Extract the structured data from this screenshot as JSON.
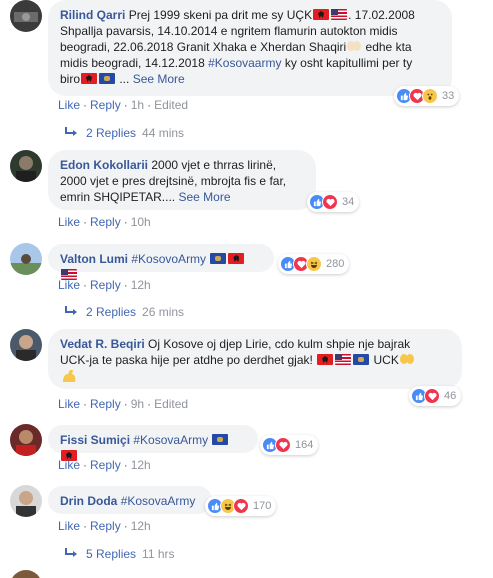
{
  "comments": [
    {
      "author": "Rilind Qarri",
      "text1": "Prej 1999 skeni pa drit me sy UÇK",
      "text2": ". 17.02.2008",
      "text3": "Shpallja pavarsis, 14.10.2014 e ngritem flamurin autokton midis",
      "text4": "beogradi, 22.06.2018 Granit Xhaka e Xherdan Shaqiri",
      "text5": " edhe kta",
      "text6": "midis beogradi, 14.12.2018 ",
      "hashtag": "#Kosovaarmy",
      "text7": " ky osht kapitullimi per ty",
      "text8": "biro",
      "see_more": "See More",
      "like": "Like",
      "reply": "Reply",
      "time": "1h",
      "edited": "Edited",
      "reaction_count": "33",
      "reactions": [
        "like",
        "love",
        "wow"
      ],
      "replies_label": "2 Replies",
      "replies_time": "44 mins"
    },
    {
      "author": "Edon Kokollarii",
      "text1": "2000 vjet e thrras lirinë,",
      "text2": "2000 vjet e pres drejtsinë, mbrojta fis e far,",
      "text3": "emrin SHQIPETAR....",
      "see_more": "See More",
      "like": "Like",
      "reply": "Reply",
      "time": "10h",
      "reaction_count": "34",
      "reactions": [
        "like",
        "love"
      ]
    },
    {
      "author": "Valton Lumi",
      "hashtag": "#KosovoArmy",
      "like": "Like",
      "reply": "Reply",
      "time": "12h",
      "reaction_count": "280",
      "reactions": [
        "like",
        "love",
        "haha"
      ],
      "replies_label": "2 Replies",
      "replies_time": "26 mins"
    },
    {
      "author": "Vedat R. Beqiri",
      "text1": "Oj Kosove oj djep Lirie, cdo kulm shpie nje bajrak",
      "text2": "UCK-ja te paska hije per atdhe po derdhet gjak!",
      "text3": "UCK",
      "like": "Like",
      "reply": "Reply",
      "time": "9h",
      "edited": "Edited",
      "reaction_count": "46",
      "reactions": [
        "like",
        "love"
      ]
    },
    {
      "author": "Fissi Sumiçi",
      "hashtag": "#KosovaArmy",
      "like": "Like",
      "reply": "Reply",
      "time": "12h",
      "reaction_count": "164",
      "reactions": [
        "like",
        "love"
      ]
    },
    {
      "author": "Drin Doda",
      "hashtag": "#KosovaArmy",
      "like": "Like",
      "reply": "Reply",
      "time": "12h",
      "reaction_count": "170",
      "reactions": [
        "like",
        "haha",
        "love"
      ],
      "replies_label": "5 Replies",
      "replies_time": "11 hrs"
    }
  ],
  "colors": {
    "bubble": "#f2f3f5",
    "author": "#385898",
    "action": "#4267b2",
    "muted": "#90949c"
  }
}
